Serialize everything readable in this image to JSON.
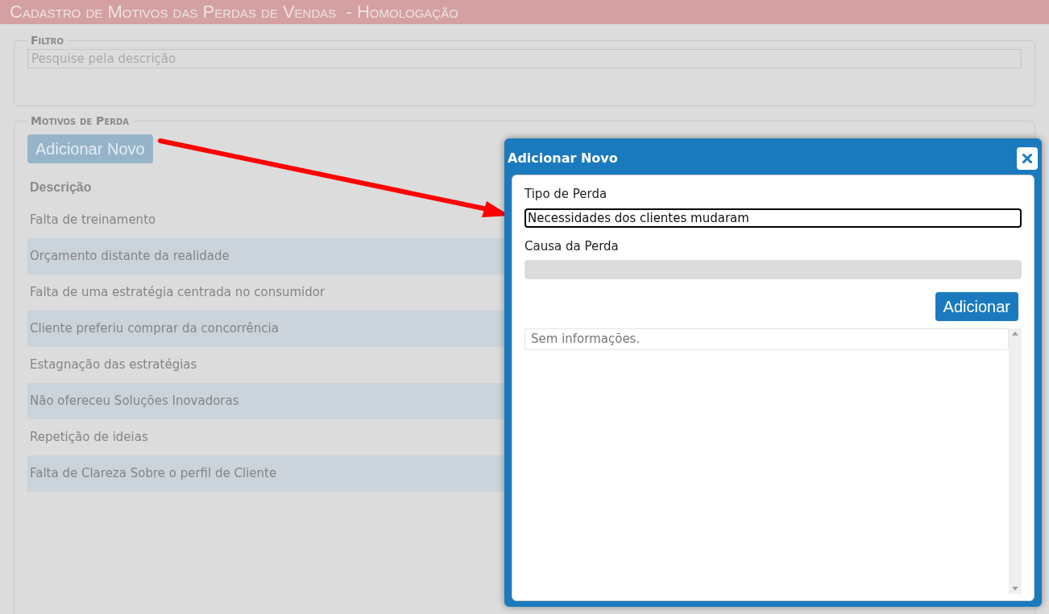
{
  "title": "Cadastro de Motivos das Perdas de Vendas  - Homologação",
  "filter": {
    "legend": "Filtro",
    "placeholder": "Pesquise pela descrição"
  },
  "motivos": {
    "legend": "Motivos de Perda",
    "add_button": "Adicionar Novo",
    "column": "Descrição",
    "rows": [
      "Falta de treinamento",
      "Orçamento distante da realidade",
      "Falta de uma estratégia centrada no consumidor",
      "Cliente preferiu comprar da concorrência",
      "Estagnação das estratégias",
      "Não ofereceu Soluções Inovadoras",
      "Repetição de ideias",
      "Falta de Clareza Sobre o perfil de Cliente"
    ]
  },
  "dialog": {
    "title": "Adicionar Novo",
    "fields": [
      {
        "label": "Tipo de Perda",
        "value": "Necessidades dos clientes mudaram",
        "focused": true,
        "disabled": false
      },
      {
        "label": "Causa da Perda",
        "focused": false,
        "disabled": true
      }
    ],
    "add_button": "Adicionar",
    "empty_text": "Sem informações."
  }
}
